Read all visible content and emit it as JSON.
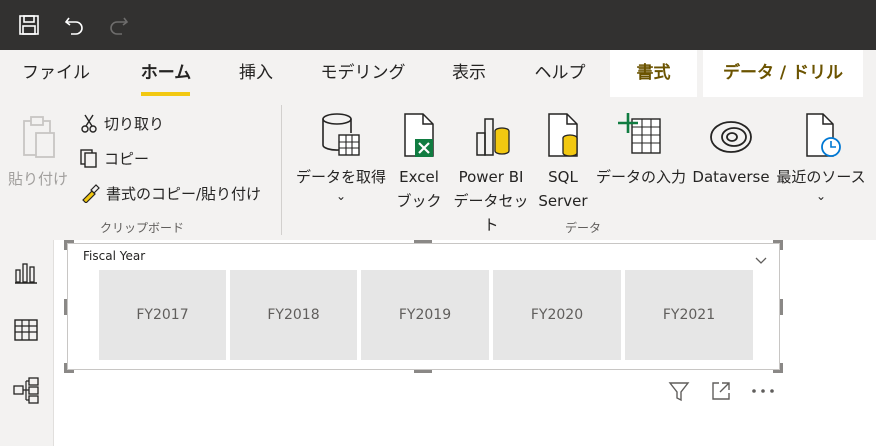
{
  "tabs": [
    {
      "label": "ファイル"
    },
    {
      "label": "ホーム"
    },
    {
      "label": "挿入"
    },
    {
      "label": "モデリング"
    },
    {
      "label": "表示"
    },
    {
      "label": "ヘルプ"
    }
  ],
  "context_tabs": [
    {
      "label": "書式"
    },
    {
      "label": "データ / ドリル"
    }
  ],
  "clipboard": {
    "paste_label": "貼り付け",
    "cut_label": "切り取り",
    "copy_label": "コピー",
    "format_painter_label": "書式のコピー/貼り付け",
    "group_label": "クリップボード"
  },
  "data_group": {
    "get_data": {
      "line1": "データを取得",
      "line2": "⌄"
    },
    "excel": {
      "line1": "Excel",
      "line2": "ブック"
    },
    "pbi": {
      "line1": "Power BI",
      "line2": "データセット"
    },
    "sql": {
      "line1": "SQL",
      "line2": "Server"
    },
    "enter_data": {
      "line1": "データの入力"
    },
    "dataverse": {
      "line1": "Dataverse"
    },
    "recent": {
      "line1": "最近のソース",
      "line2": "⌄"
    },
    "group_label": "データ"
  },
  "slicer": {
    "title": "Fiscal Year",
    "items": [
      "FY2017",
      "FY2018",
      "FY2019",
      "FY2020",
      "FY2021"
    ]
  },
  "icons": {
    "save": "save-icon",
    "undo": "undo-icon",
    "redo": "redo-icon",
    "filter": "filter-icon",
    "focus": "focus-mode-icon",
    "more": "more-options-icon"
  }
}
